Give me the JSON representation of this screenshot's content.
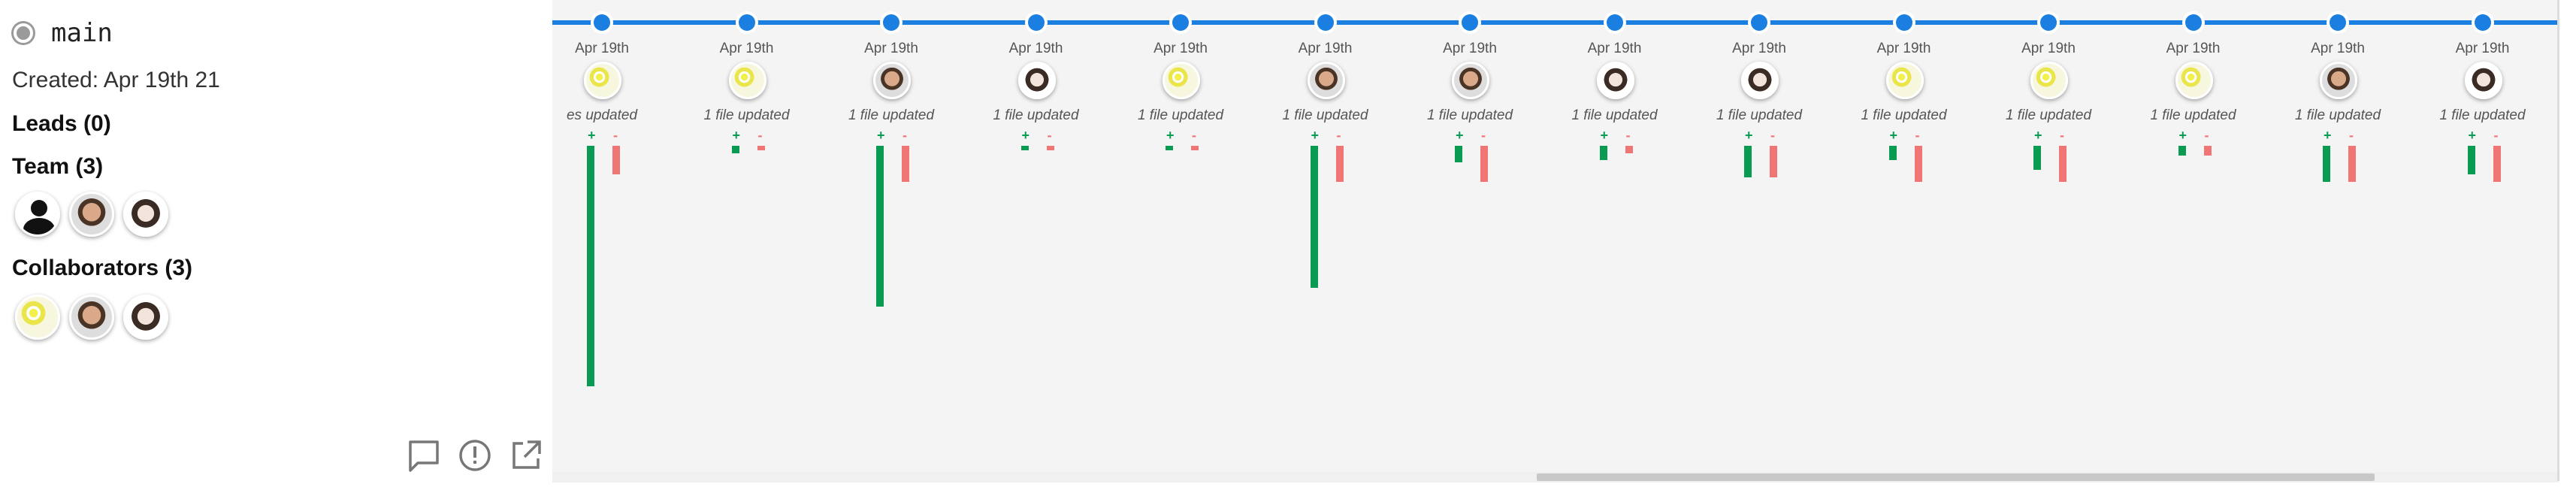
{
  "sidebar": {
    "branch_name": "main",
    "created": "Created: Apr 19th 21",
    "leads_title": "Leads (0)",
    "team_title": "Team (3)",
    "team_avatars": [
      "user-silhouette",
      "man-portrait",
      "woman-cartoon"
    ],
    "collaborators_title": "Collaborators (3)",
    "collaborator_avatars": [
      "cartoon-flowers",
      "man-portrait",
      "woman-cartoon"
    ]
  },
  "actions": {
    "comment_icon": "comment-icon",
    "alert_icon": "alert-icon",
    "open_external_icon": "open-external-icon"
  },
  "timeline": {
    "accent_color": "#1a7fe0",
    "add_color": "#0a9b53",
    "delete_color": "#f07575",
    "plus_label": "+",
    "minus_label": "-",
    "commits": [
      {
        "date": "Apr 19th",
        "files": "es updated",
        "avatar": "cartoon",
        "add": 1.0,
        "del": 0.12
      },
      {
        "date": "Apr 19th",
        "files": "1 file updated",
        "avatar": "cartoon",
        "add": 0.03,
        "del": 0.02
      },
      {
        "date": "Apr 19th",
        "files": "1 file updated",
        "avatar": "man",
        "add": 0.67,
        "del": 0.15
      },
      {
        "date": "Apr 19th",
        "files": "1 file updated",
        "avatar": "woman",
        "add": 0.02,
        "del": 0.02
      },
      {
        "date": "Apr 19th",
        "files": "1 file updated",
        "avatar": "cartoon",
        "add": 0.02,
        "del": 0.02
      },
      {
        "date": "Apr 19th",
        "files": "1 file updated",
        "avatar": "man",
        "add": 0.59,
        "del": 0.15
      },
      {
        "date": "Apr 19th",
        "files": "1 file updated",
        "avatar": "man",
        "add": 0.07,
        "del": 0.15
      },
      {
        "date": "Apr 19th",
        "files": "1 file updated",
        "avatar": "woman",
        "add": 0.06,
        "del": 0.03
      },
      {
        "date": "Apr 19th",
        "files": "1 file updated",
        "avatar": "woman",
        "add": 0.13,
        "del": 0.13
      },
      {
        "date": "Apr 19th",
        "files": "1 file updated",
        "avatar": "cartoon",
        "add": 0.06,
        "del": 0.15
      },
      {
        "date": "Apr 19th",
        "files": "1 file updated",
        "avatar": "cartoon",
        "add": 0.1,
        "del": 0.15
      },
      {
        "date": "Apr 19th",
        "files": "1 file updated",
        "avatar": "cartoon",
        "add": 0.04,
        "del": 0.04
      },
      {
        "date": "Apr 19th",
        "files": "1 file updated",
        "avatar": "man",
        "add": 0.15,
        "del": 0.15
      },
      {
        "date": "Apr 19th",
        "files": "1 file updated",
        "avatar": "woman",
        "add": 0.12,
        "del": 0.15
      }
    ]
  },
  "scrollbar": {
    "horizontal_position": 0.64
  }
}
